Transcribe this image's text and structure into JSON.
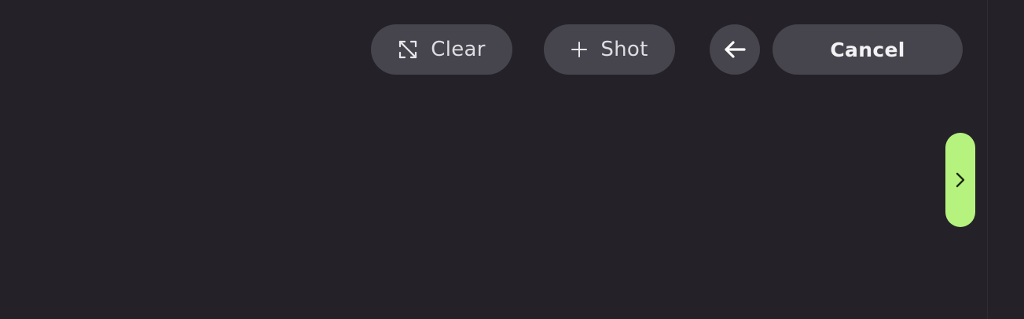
{
  "toolbar": {
    "clear_label": "Clear",
    "shot_label": "Shot",
    "cancel_label": "Cancel"
  },
  "icons": {
    "clear": "collapse-corners-icon",
    "shot": "plus-icon",
    "back": "arrow-left-icon",
    "side_tab": "chevron-right-icon"
  },
  "colors": {
    "background": "#242228",
    "button_bg": "#46454d",
    "button_text": "#dedde3",
    "side_tab_accent": "#b6f27e"
  }
}
